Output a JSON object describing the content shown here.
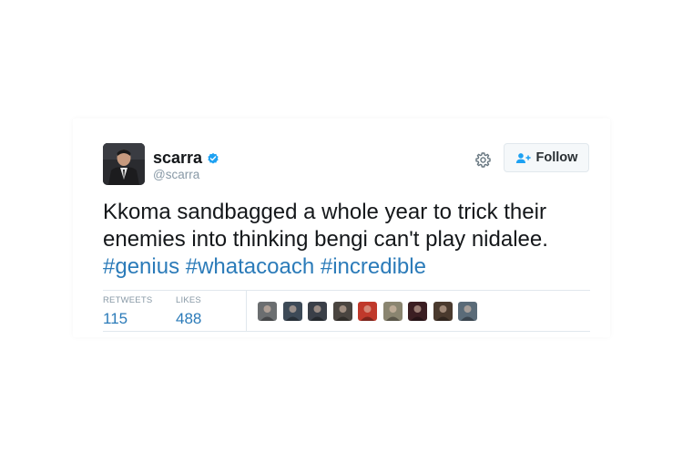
{
  "user": {
    "name": "scarra",
    "handle": "@scarra",
    "verified_icon": "verified-badge-icon",
    "avatar_icon": "user-avatar"
  },
  "actions": {
    "settings_icon": "gear-icon",
    "follow_icon": "add-user-icon",
    "follow_label": "Follow"
  },
  "tweet": {
    "line1": "Kkoma sandbagged a whole year to trick their",
    "line2": "enemies into thinking bengi can't play nidalee.",
    "hashtags": [
      "#genius",
      "#whatacoach",
      "#incredible"
    ]
  },
  "stats": {
    "retweets_label": "RETWEETS",
    "retweets_value": "115",
    "likes_label": "LIKES",
    "likes_value": "488"
  },
  "likers": [
    {
      "color": "#6b6e70"
    },
    {
      "color": "#3d4a57"
    },
    {
      "color": "#3a3f48"
    },
    {
      "color": "#4a4540"
    },
    {
      "color": "#c0392b"
    },
    {
      "color": "#8a8570"
    },
    {
      "color": "#3b1e22"
    },
    {
      "color": "#4a3a2e"
    },
    {
      "color": "#5a6b78"
    }
  ],
  "colors": {
    "link": "#2b7bb9",
    "verified": "#1da1f2",
    "muted": "#8899a6"
  }
}
